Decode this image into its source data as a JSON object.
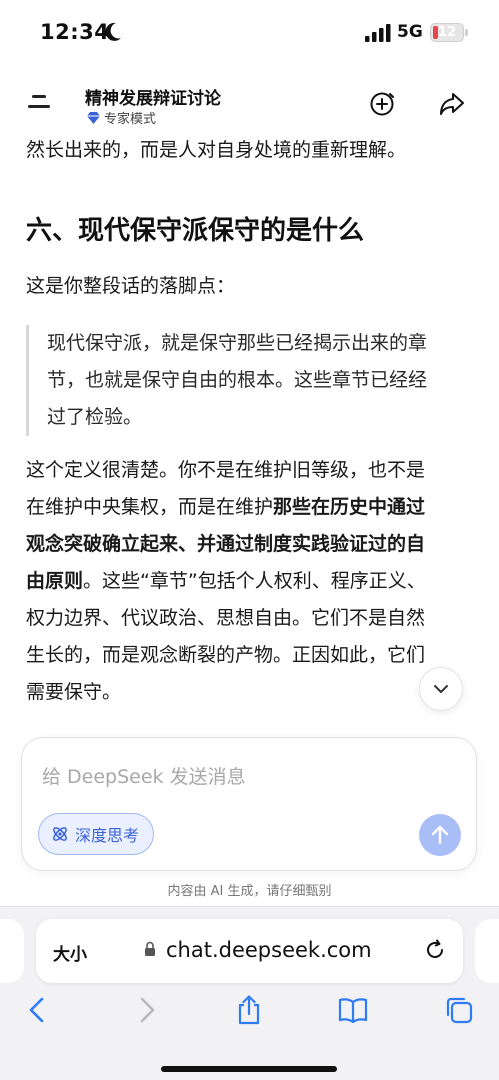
{
  "status_bar": {
    "time": "12:34",
    "network": "5G",
    "battery": "12",
    "battery_color": "#e5484d"
  },
  "header": {
    "menu_icon": "menu-icon",
    "title": "精神发展辩证讨论",
    "mode_label": "专家模式",
    "new_chat_icon": "plus-circle-icon",
    "share_icon": "share-icon"
  },
  "content": {
    "prev_tail": "然长出来的，而是人对自身处境的重新理解。",
    "heading": "六、现代保守派保守的是什么",
    "intro": "这是你整段话的落脚点：",
    "quote_lines": [
      "现代保守派，就是保守那些已经揭示出来的章",
      "节，也就是保守自由的根本。这些章节已经经",
      "过了检验。"
    ],
    "body_lines": [
      {
        "plain": "这个定义很清楚。你不是在维护旧等级，也不是",
        "bold": ""
      },
      {
        "plain": "在维护中央集权，而是在维护",
        "bold": "那些在历史中通过"
      },
      {
        "plain": "",
        "bold": "观念突破确立起来、并通过制度实践验证过的自"
      },
      {
        "bold": "由原则",
        "plain": "。这些“章节”包括个人权利、程序正义、"
      },
      {
        "plain": "权力边界、代议政治、思想自由。它们不是自然",
        "bold": ""
      },
      {
        "plain": "生长的，而是观念断裂的产物。正因如此，它们",
        "bold": ""
      },
      {
        "plain": "需要保守。",
        "bold": ""
      }
    ]
  },
  "composer": {
    "placeholder": "给 DeepSeek 发送消息",
    "deepthink_label": "深度思考",
    "accent": "#3b63d6"
  },
  "disclaimer": "内容由 AI 生成，请仔细甄别",
  "browser": {
    "text_size_label": "大小",
    "url": "chat.deepseek.com"
  }
}
